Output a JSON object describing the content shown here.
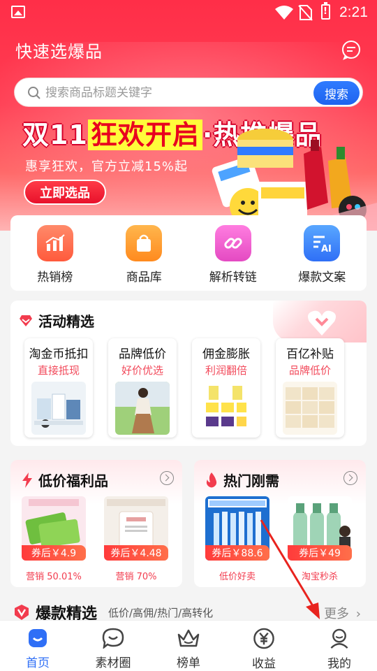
{
  "status_bar": {
    "time": "2:21"
  },
  "header": {
    "title": "快速选爆品"
  },
  "search": {
    "placeholder": "搜索商品标题关键字",
    "button_label": "搜索"
  },
  "banner": {
    "title_part1": "双11",
    "title_highlight": "狂欢开启",
    "title_part2": "·热推爆品",
    "subtitle": "惠享狂欢，官方立减15%起",
    "cta_label": "立即选品"
  },
  "quick_nav": [
    {
      "label": "热销榜",
      "icon": "bar-chart-icon",
      "color": "#ff6a4d"
    },
    {
      "label": "商品库",
      "icon": "shopping-bag-icon",
      "color": "#ff9a2e"
    },
    {
      "label": "解析转链",
      "icon": "link-icon",
      "color": "#f25bd0"
    },
    {
      "label": "爆款文案",
      "icon": "ai-document-icon",
      "color": "#3c8cff"
    }
  ],
  "activity": {
    "title": "活动精选",
    "cards": [
      {
        "title": "淘金币抵扣",
        "subtitle": "直接抵现"
      },
      {
        "title": "品牌低价",
        "subtitle": "好价优选"
      },
      {
        "title": "佣金膨胀",
        "subtitle": "利润翻倍"
      },
      {
        "title": "百亿补贴",
        "subtitle": "品牌低价"
      }
    ]
  },
  "feature_left": {
    "title": "低价福利品",
    "items": [
      {
        "price": "券后￥4.9",
        "caption": "营销 50.01%"
      },
      {
        "price": "券后￥4.48",
        "caption": "营销 70%"
      }
    ]
  },
  "feature_right": {
    "title": "热门刚需",
    "items": [
      {
        "price": "券后￥88.6",
        "caption": "低价好卖"
      },
      {
        "price": "券后￥49",
        "caption": "淘宝秒杀"
      }
    ]
  },
  "hot_picks": {
    "title": "爆款精选",
    "tags": "低价/高佣/热门/高转化",
    "more_label": "更多"
  },
  "tabbar": [
    {
      "label": "首页",
      "icon": "home-icon",
      "active": true
    },
    {
      "label": "素材圈",
      "icon": "chat-bubble-icon",
      "active": false
    },
    {
      "label": "榜单",
      "icon": "crown-icon",
      "active": false
    },
    {
      "label": "收益",
      "icon": "yen-coin-icon",
      "active": false
    },
    {
      "label": "我的",
      "icon": "user-icon",
      "active": false
    }
  ],
  "colors": {
    "brand_red": "#ff2e48",
    "accent_blue": "#2f6ff6",
    "price_red": "#f23c4e"
  }
}
